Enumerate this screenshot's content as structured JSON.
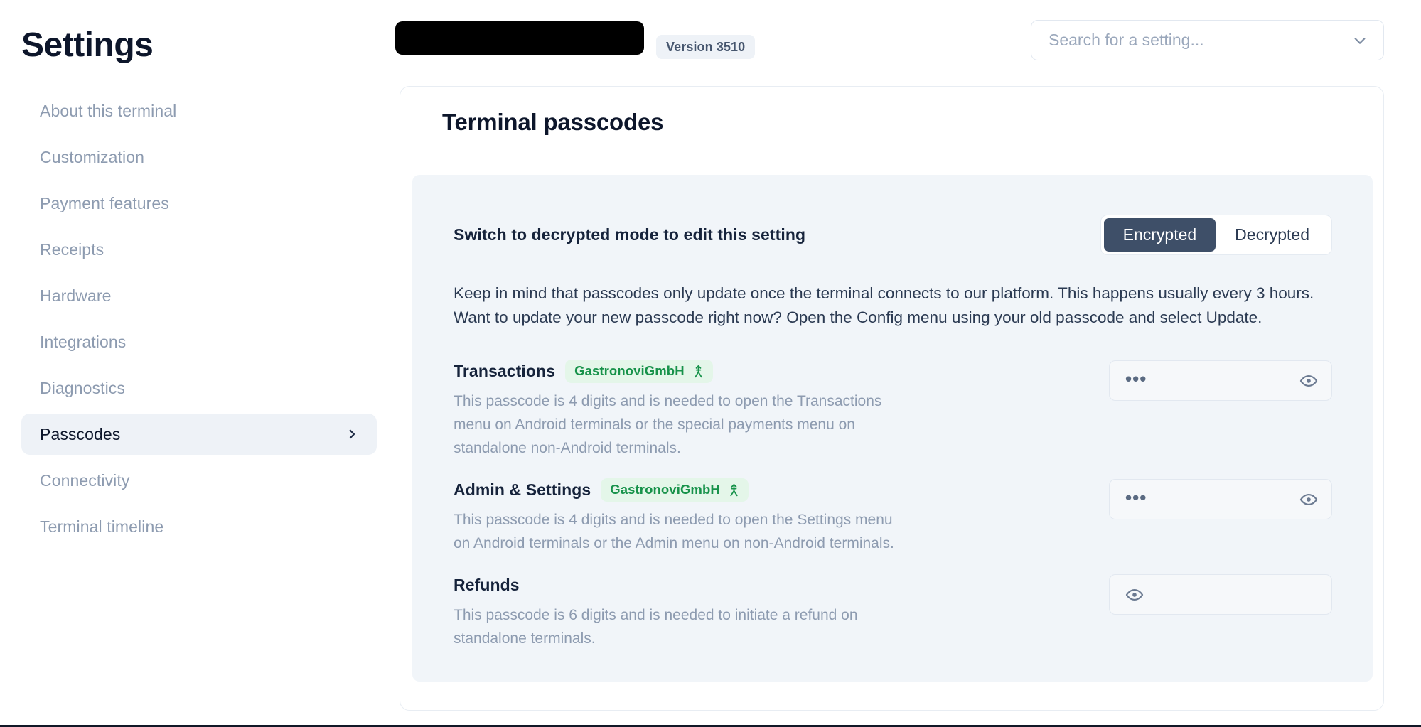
{
  "app": {
    "title": "Settings"
  },
  "sidebar": {
    "items": [
      {
        "label": "About this terminal",
        "active": false
      },
      {
        "label": "Customization",
        "active": false
      },
      {
        "label": "Payment features",
        "active": false
      },
      {
        "label": "Receipts",
        "active": false
      },
      {
        "label": "Hardware",
        "active": false
      },
      {
        "label": "Integrations",
        "active": false
      },
      {
        "label": "Diagnostics",
        "active": false
      },
      {
        "label": "Passcodes",
        "active": true
      },
      {
        "label": "Connectivity",
        "active": false
      },
      {
        "label": "Terminal timeline",
        "active": false
      }
    ]
  },
  "topbar": {
    "terminal_name_redacted": "",
    "version_badge": "Version 3510",
    "search": {
      "placeholder": "Search for a setting...",
      "value": "",
      "chevron_icon": "chevron-down-icon"
    }
  },
  "main": {
    "title": "Terminal passcodes",
    "mode": {
      "label": "Switch to decrypted mode to edit this setting",
      "options": [
        "Encrypted",
        "Decrypted"
      ],
      "selected": "Encrypted"
    },
    "note": "Keep in mind that passcodes only update once the terminal connects to our platform. This happens usually every 3 hours. Want to update your new passcode right now? Open the Config menu using your old passcode and select Update.",
    "passcodes": [
      {
        "name": "Transactions",
        "owner": "GastronoviGmbH",
        "owner_icon": "inheritance-arrow-icon",
        "description": "This passcode is 4 digits and is needed to open the Transactions menu on Android terminals or the special payments menu on standalone non-Android terminals.",
        "value_masked": "•••",
        "reveal_icon": "eye-icon"
      },
      {
        "name": "Admin & Settings",
        "owner": "GastronoviGmbH",
        "owner_icon": "inheritance-arrow-icon",
        "description": "This passcode is 4 digits and is needed to open the Settings menu on Android terminals or the Admin menu on non-Android terminals.",
        "value_masked": "•••",
        "reveal_icon": "eye-icon"
      },
      {
        "name": "Refunds",
        "owner": "",
        "owner_icon": "",
        "description": "This passcode is 6 digits and is needed to initiate a refund on standalone terminals.",
        "value_masked": "",
        "reveal_icon": "eye-icon"
      }
    ]
  },
  "colors": {
    "accent_dark": "#3e4f68",
    "badge_green_text": "#17924a",
    "badge_green_bg": "#e4f6e9",
    "panel_bg": "#f1f5f9",
    "muted_text": "#8d9bb0",
    "heading": "#0d162b"
  }
}
